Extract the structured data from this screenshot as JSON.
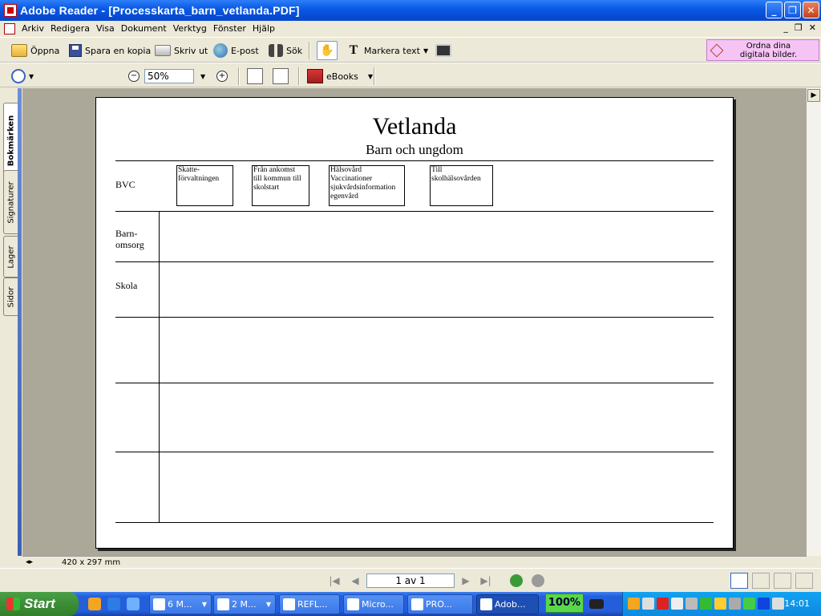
{
  "window": {
    "title": "Adobe Reader - [Processkarta_barn_vetlanda.PDF]"
  },
  "menu": [
    "Arkiv",
    "Redigera",
    "Visa",
    "Dokument",
    "Verktyg",
    "Fönster",
    "Hjälp"
  ],
  "toolbar": {
    "open": "Öppna",
    "save_copy": "Spara en kopia",
    "print": "Skriv ut",
    "email": "E-post",
    "search": "Sök",
    "select_text": "Markera text"
  },
  "promo": {
    "line1": "Ordna dina",
    "line2": "digitala bilder."
  },
  "zoom": {
    "value": "50%"
  },
  "ebooks": "eBooks",
  "nav_tabs": [
    "Bokmärken",
    "Signaturer",
    "Lager",
    "Sidor"
  ],
  "document": {
    "title": "Vetlanda",
    "subtitle": "Barn och ungdom",
    "rows": [
      {
        "label_line1": "BVC",
        "label_line2": ""
      },
      {
        "label_line1": "Barn-",
        "label_line2": "omsorg"
      },
      {
        "label_line1": "Skola",
        "label_line2": ""
      }
    ],
    "boxes": [
      {
        "lines": [
          "Skatte-",
          "förvaltningen"
        ]
      },
      {
        "lines": [
          "Från ankomst",
          "till kommun till",
          "skolstart"
        ]
      },
      {
        "lines": [
          "Hälsovård",
          "Vaccinationer",
          "sjukvårdsinformation",
          "egenvård"
        ]
      },
      {
        "lines": [
          "Till",
          "skolhälsovården"
        ]
      }
    ]
  },
  "status": {
    "page_size": "420 x 297 mm"
  },
  "pagination": {
    "current": "1 av 1"
  },
  "taskbar": {
    "start": "Start",
    "tasks": [
      "6 M...",
      "2 M...",
      "REFL...",
      "Micro...",
      "PRO...",
      "Adob..."
    ],
    "battery": "100%",
    "clock": "14:01"
  },
  "colors": {
    "title_bar": "#0a5be5",
    "taskbar": "#245edb",
    "start": "#3c8e36",
    "promo": "#f6c4f4",
    "workspace": "#aca899"
  }
}
